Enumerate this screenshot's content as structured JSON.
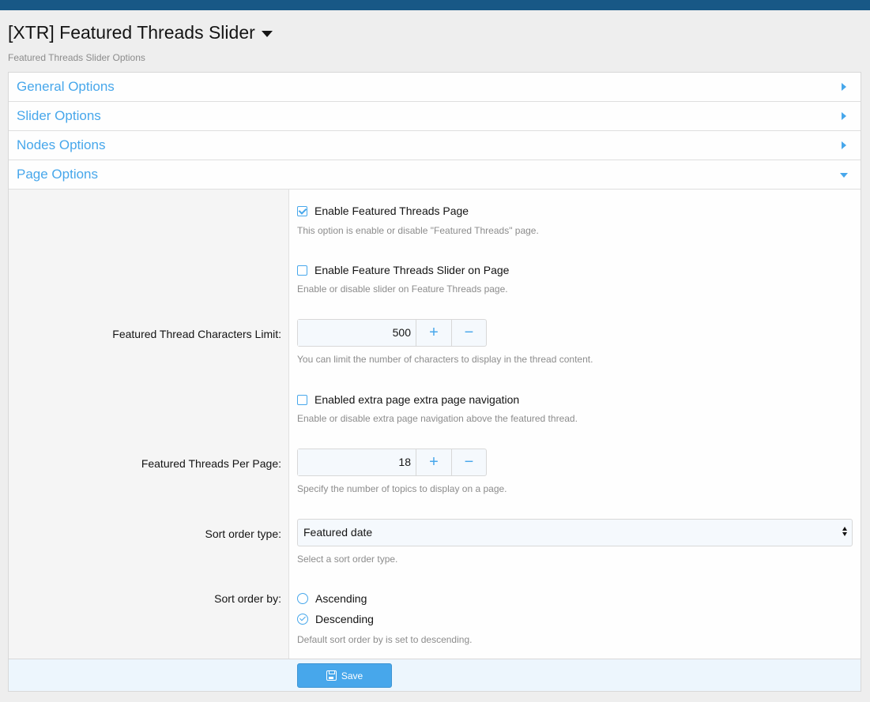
{
  "header": {
    "title": "[XTR] Featured Threads Slider",
    "description": "Featured Threads Slider Options"
  },
  "sections": [
    {
      "label": "General Options",
      "expanded": false
    },
    {
      "label": "Slider Options",
      "expanded": false
    },
    {
      "label": "Nodes Options",
      "expanded": false
    },
    {
      "label": "Page Options",
      "expanded": true
    }
  ],
  "page_options": {
    "enable_page": {
      "label": "Enable Featured Threads Page",
      "checked": true,
      "hint": "This option is enable or disable \"Featured Threads\" page."
    },
    "enable_slider": {
      "label": "Enable Feature Threads Slider on Page",
      "checked": false,
      "hint": "Enable or disable slider on Feature Threads page."
    },
    "char_limit": {
      "label": "Featured Thread Characters Limit:",
      "value": "500",
      "hint": "You can limit the number of characters to display in the thread content."
    },
    "extra_nav": {
      "label": "Enabled extra page extra page navigation",
      "checked": false,
      "hint": "Enable or disable extra page navigation above the featured thread."
    },
    "per_page": {
      "label": "Featured Threads Per Page:",
      "value": "18",
      "hint": "Specify the number of topics to display on a page."
    },
    "sort_type": {
      "label": "Sort order type:",
      "value": "Featured date",
      "hint": "Select a sort order type."
    },
    "sort_by": {
      "label": "Sort order by:",
      "options": [
        "Ascending",
        "Descending"
      ],
      "selected": "Descending",
      "hint": "Default sort order by is set to descending."
    }
  },
  "footer": {
    "save_label": "Save"
  },
  "icons": {
    "plus": "+",
    "minus": "−"
  },
  "colors": {
    "accent": "#47a7eb",
    "top_bar": "#185886"
  }
}
